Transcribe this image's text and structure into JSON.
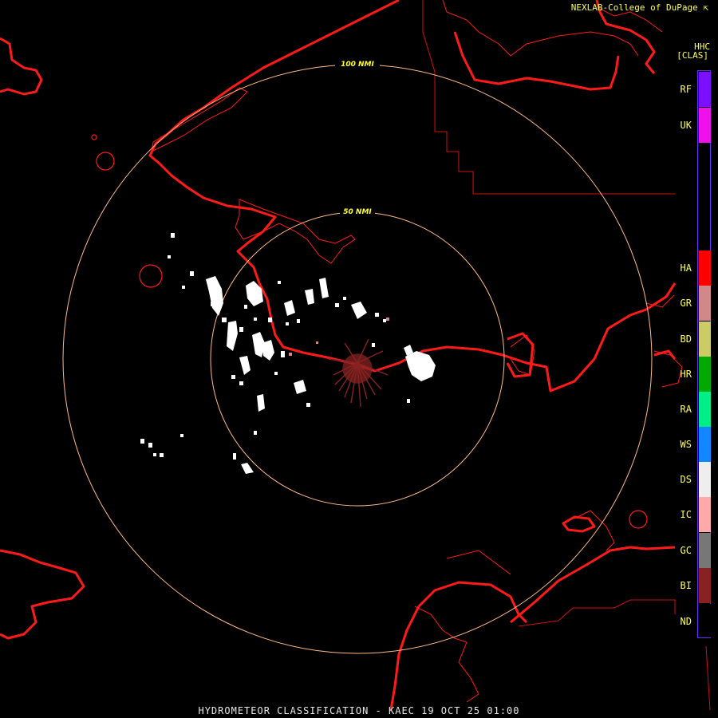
{
  "header": {
    "credit": "NEXLAB-College of DuPage",
    "product": "HHC",
    "product_code": "[CLAS]"
  },
  "footer": {
    "title": "HYDROMETEOR CLASSIFICATION - KAEC 19 OCT 25 01:00"
  },
  "rings": [
    {
      "label": "50 NMI",
      "range_nmi": 50
    },
    {
      "label": "100 NMI",
      "range_nmi": 100
    }
  ],
  "legend": {
    "items": [
      {
        "code": "RF",
        "color": "#7a10ff"
      },
      {
        "code": "UK",
        "color": "#ee11ee"
      },
      {
        "code": "HA",
        "color": "#ff0000"
      },
      {
        "code": "GR",
        "color": "#d08888"
      },
      {
        "code": "BD",
        "color": "#cccc66"
      },
      {
        "code": "HR",
        "color": "#00aa00"
      },
      {
        "code": "RA",
        "color": "#00ee88"
      },
      {
        "code": "WS",
        "color": "#1188ff"
      },
      {
        "code": "DS",
        "color": "#eeeeee"
      },
      {
        "code": "IC",
        "color": "#ffaaaa"
      },
      {
        "code": "GC",
        "color": "#777777"
      },
      {
        "code": "BI",
        "color": "#882222"
      },
      {
        "code": "ND",
        "color": "#000000"
      }
    ]
  },
  "colors": {
    "coast": "#ff1a1a",
    "ring": "#ffbb88",
    "border": "#cc1111",
    "echo": "#ffffff",
    "clutter": "#882222"
  },
  "icons": {
    "credit_mark": "corner-arrow-icon"
  }
}
